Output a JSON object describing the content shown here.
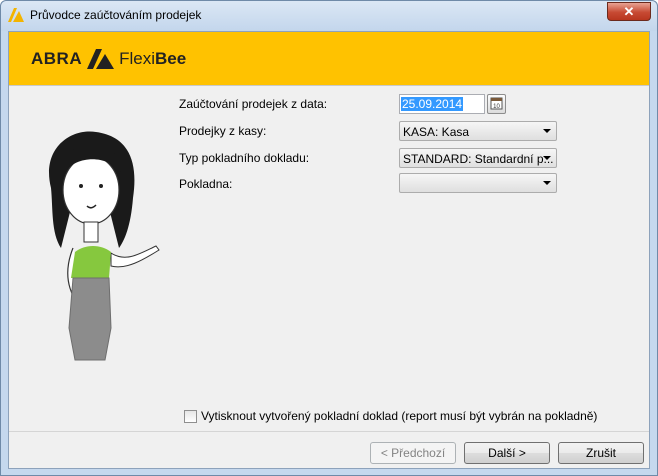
{
  "window": {
    "title": "Průvodce zaúčtováním prodejek",
    "close_label": "✕"
  },
  "banner": {
    "brand_abra": "ABRA",
    "brand_flexi": "Flexi",
    "brand_bee": "Bee"
  },
  "form": {
    "date_label": "Zaúčtování prodejek z data:",
    "date_value": "25.09.2014",
    "register_label": "Prodejky z kasy:",
    "register_value": "KASA: Kasa",
    "doc_type_label": "Typ pokladního dokladu:",
    "doc_type_value": "STANDARD: Standardní p...",
    "cash_label": "Pokladna:",
    "cash_value": "",
    "print_checkbox_label": "Vytisknout vytvořený pokladní doklad (report musí být vybrán na pokladně)",
    "print_checked": false
  },
  "buttons": {
    "prev_label": "< Předchozí",
    "next_label": "Další >",
    "cancel_label": "Zrušit"
  },
  "icons": {
    "app_icon": "abra-logo-icon",
    "calendar_icon": "calendar-icon"
  },
  "colors": {
    "banner": "#ffc200",
    "selection": "#3399ff"
  }
}
